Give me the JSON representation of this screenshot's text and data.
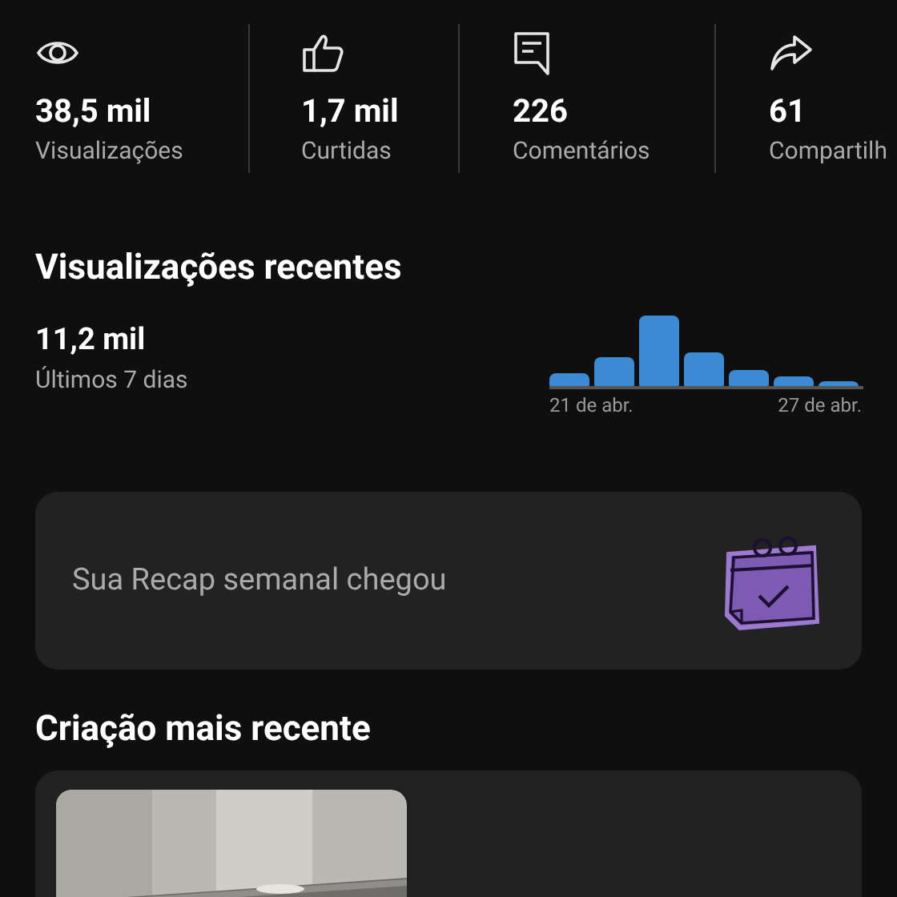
{
  "stats": [
    {
      "kind": "views",
      "value": "38,5 mil",
      "label": "Visualizações"
    },
    {
      "kind": "likes",
      "value": "1,7 mil",
      "label": "Curtidas"
    },
    {
      "kind": "comments",
      "value": "226",
      "label": "Comentários"
    },
    {
      "kind": "shares",
      "value": "61",
      "label": "Compartilh"
    }
  ],
  "recent_views": {
    "title": "Visualizações recentes",
    "value": "11,2 mil",
    "period": "Últimos 7 dias",
    "start_label": "21 de abr.",
    "end_label": "27 de abr."
  },
  "recap_card": {
    "text": "Sua Recap semanal chegou"
  },
  "latest_creation": {
    "title": "Criação mais recente"
  }
}
